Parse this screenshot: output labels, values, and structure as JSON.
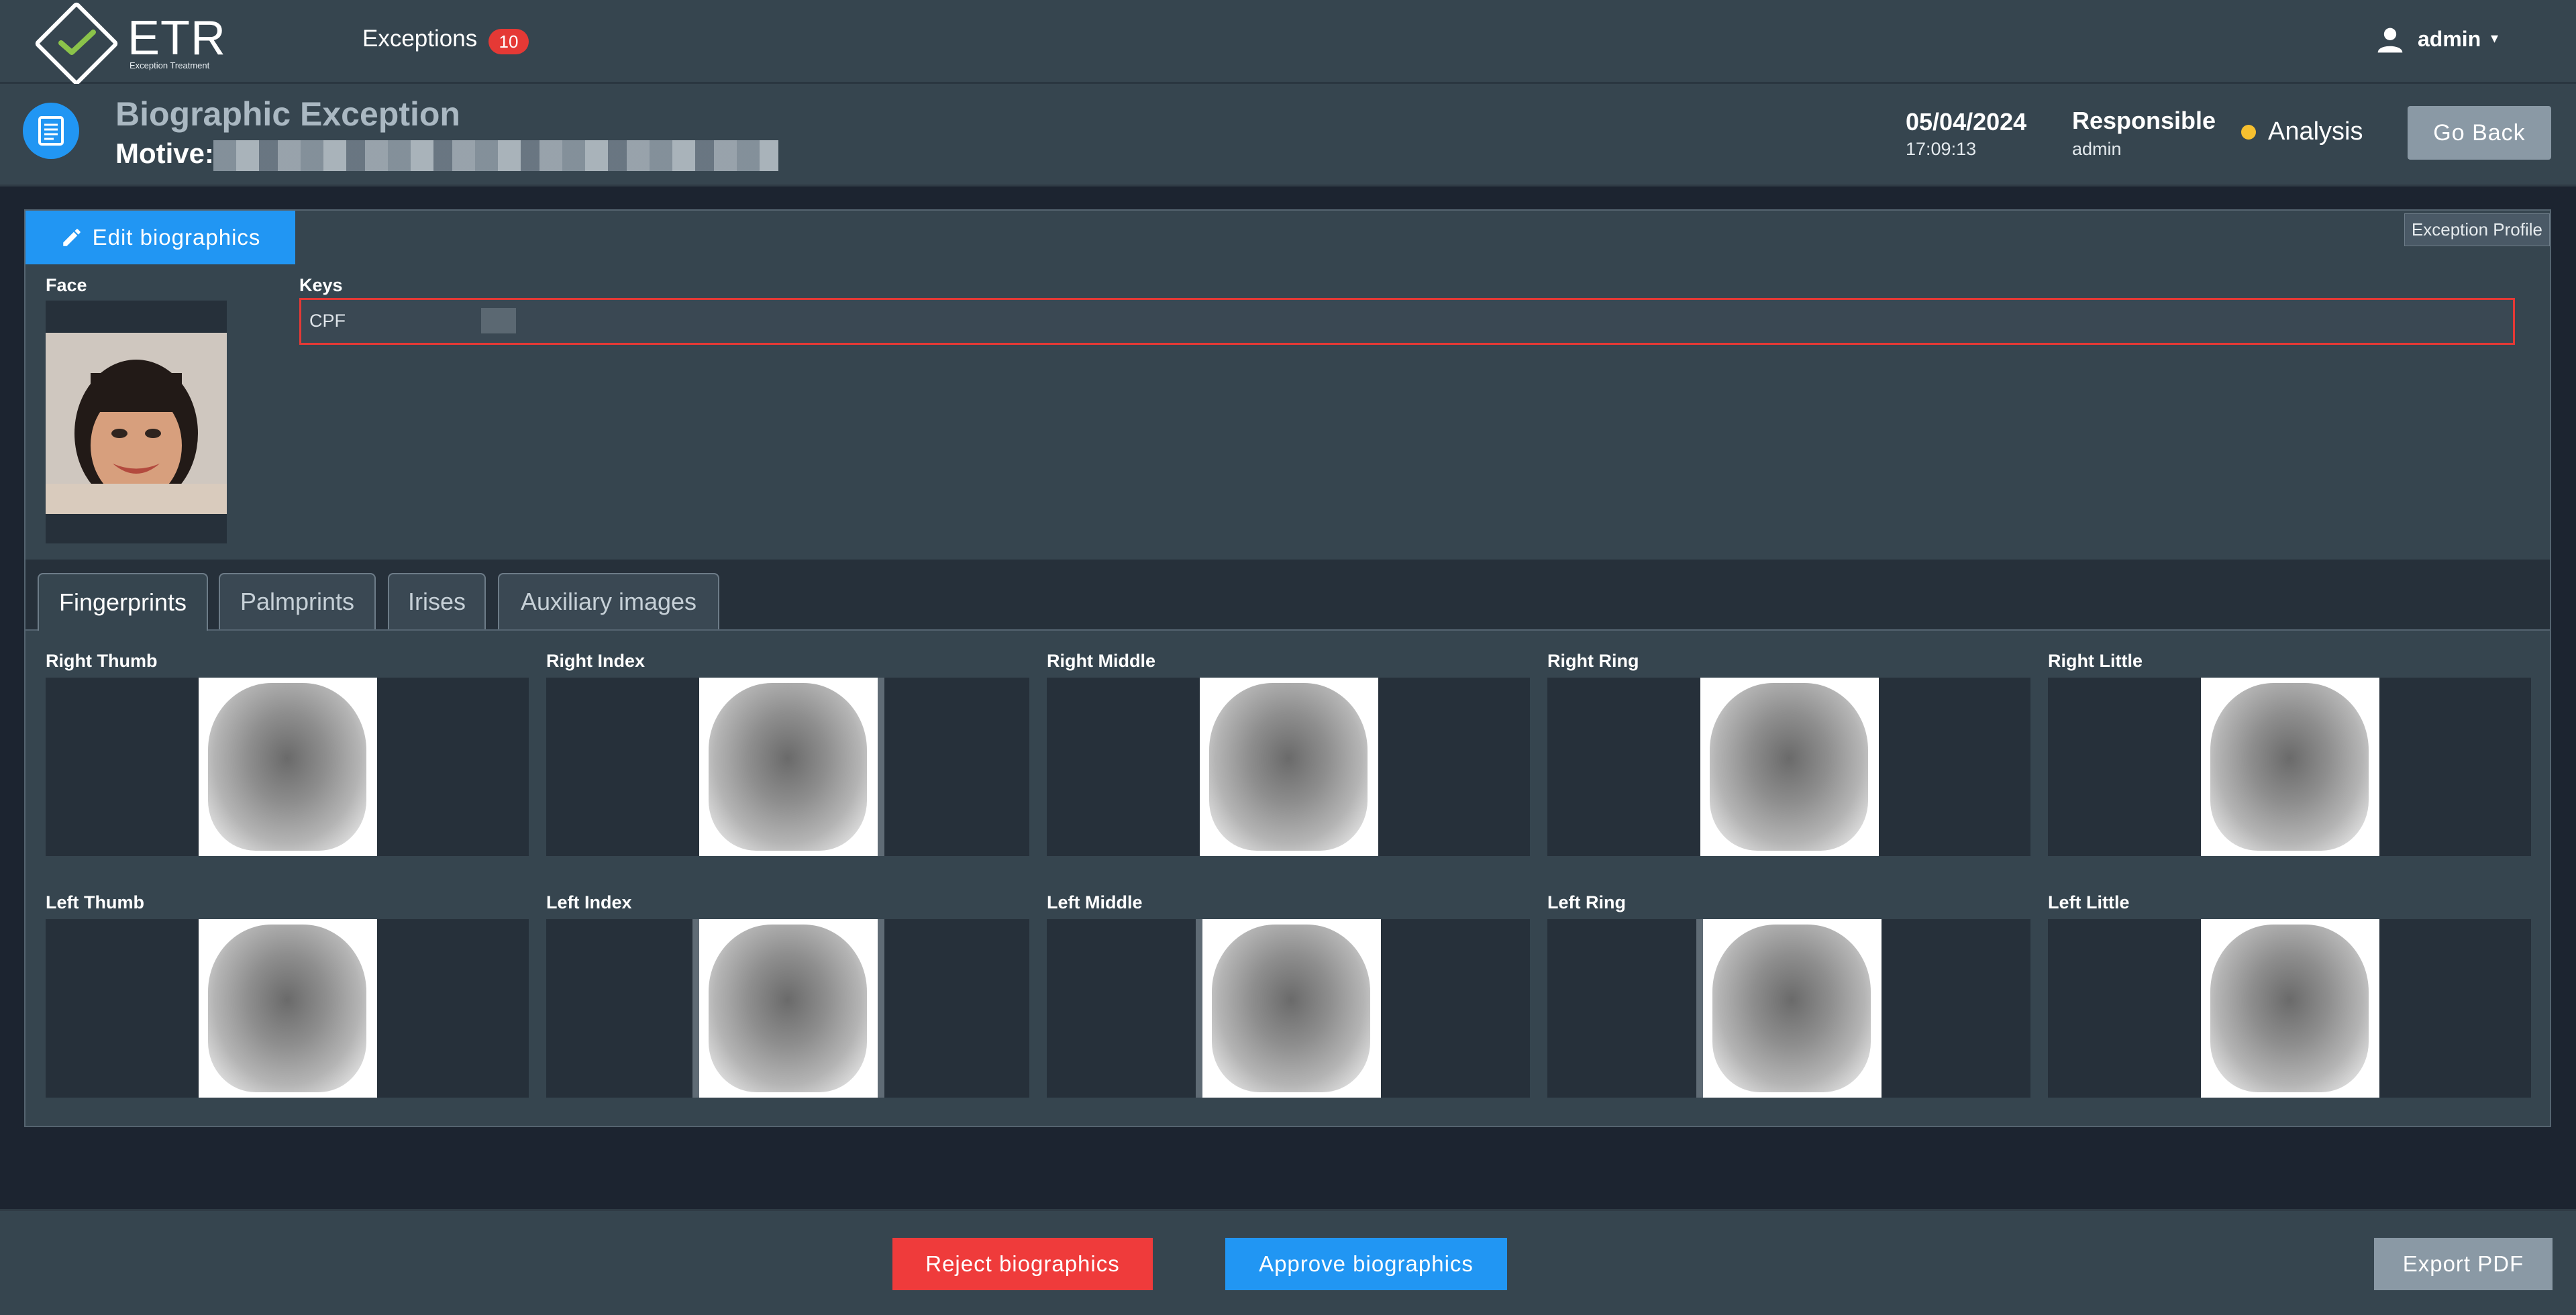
{
  "app": {
    "logo_text": "ETR",
    "logo_subtitle": "Exception Treatment"
  },
  "nav": {
    "exceptions_label": "Exceptions",
    "exceptions_count": "10",
    "user_name": "admin",
    "user_caret": "▾"
  },
  "header": {
    "title": "Biographic Exception",
    "motive_label": "Motive:",
    "date": "05/04/2024",
    "time": "17:09:13",
    "responsible_label": "Responsible",
    "responsible_value": "admin",
    "status": "Analysis",
    "status_color": "#f7c02f",
    "go_back_label": "Go Back"
  },
  "card": {
    "edit_label": "Edit biographics",
    "profile_tag": "Exception Profile",
    "face_label": "Face",
    "keys_label": "Keys",
    "key_name": "CPF"
  },
  "tabs": [
    {
      "label": "Fingerprints",
      "active": true
    },
    {
      "label": "Palmprints",
      "active": false
    },
    {
      "label": "Irises",
      "active": false
    },
    {
      "label": "Auxiliary images",
      "active": false
    }
  ],
  "fingerprints": [
    {
      "label": "Right Thumb"
    },
    {
      "label": "Right Index"
    },
    {
      "label": "Right Middle"
    },
    {
      "label": "Right Ring"
    },
    {
      "label": "Right Little"
    },
    {
      "label": "Left Thumb"
    },
    {
      "label": "Left Index"
    },
    {
      "label": "Left Middle"
    },
    {
      "label": "Left Ring"
    },
    {
      "label": "Left Little"
    }
  ],
  "footer": {
    "reject_label": "Reject biographics",
    "approve_label": "Approve biographics",
    "export_label": "Export PDF"
  },
  "colors": {
    "primary": "#2196f3",
    "danger": "#ef3b3b",
    "panel": "#36454f",
    "background": "#1c2430"
  }
}
